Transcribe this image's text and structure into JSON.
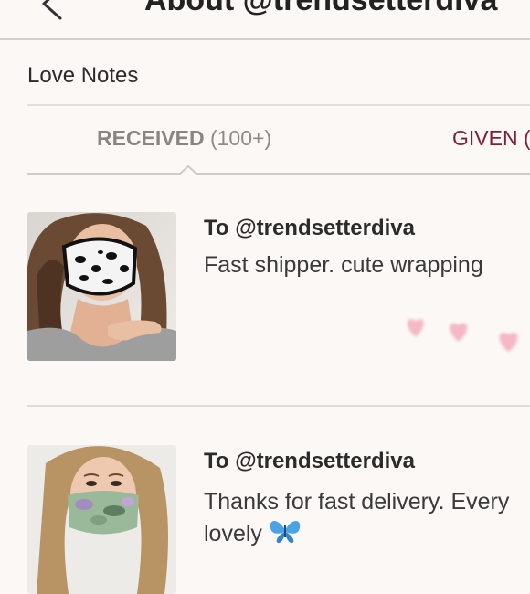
{
  "header": {
    "title": "About @trendsetterdiva",
    "back_icon": "chevron-left-icon"
  },
  "section": {
    "title": "Love Notes"
  },
  "tabs": [
    {
      "label": "RECEIVED",
      "count": "(100+)",
      "selected": true
    },
    {
      "label": "GIVEN (",
      "selected": false
    }
  ],
  "notes": [
    {
      "to": "To @trendsetterdiva",
      "text": "Fast shipper. cute wrapping",
      "image": "leopard-print-mask-photo",
      "decoration": "hearts-icon"
    },
    {
      "to": "To @trendsetterdiva",
      "text": "Thanks for fast delivery. Every",
      "text_2": "lovely",
      "emoji": "butterfly-icon",
      "image": "camo-mask-photo"
    }
  ],
  "colors": {
    "background": "#fbf8f6",
    "given_tab": "#7a2038",
    "received_tab": "#8a8583",
    "hearts": "#f5b8c4"
  }
}
